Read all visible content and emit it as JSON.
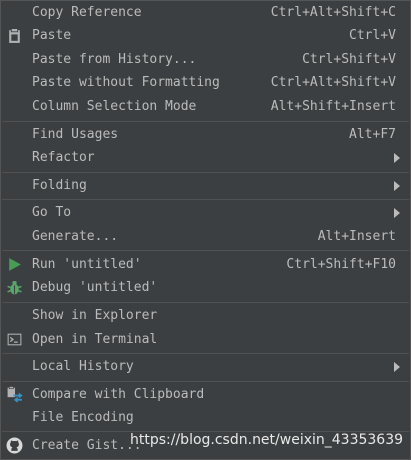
{
  "menu": {
    "copy_reference": {
      "label": "Copy Reference",
      "shortcut": "Ctrl+Alt+Shift+C"
    },
    "paste": {
      "label": "Paste",
      "shortcut": "Ctrl+V",
      "icon": "clipboard-icon"
    },
    "paste_from_history": {
      "label": "Paste from History...",
      "shortcut": "Ctrl+Shift+V"
    },
    "paste_without_formatting": {
      "label": "Paste without Formatting",
      "shortcut": "Ctrl+Alt+Shift+V"
    },
    "column_selection_mode": {
      "label": "Column Selection Mode",
      "shortcut": "Alt+Shift+Insert"
    },
    "find_usages": {
      "label": "Find Usages",
      "shortcut": "Alt+F7"
    },
    "refactor": {
      "label": "Refactor",
      "has_submenu": true
    },
    "folding": {
      "label": "Folding",
      "has_submenu": true
    },
    "go_to": {
      "label": "Go To",
      "has_submenu": true
    },
    "generate": {
      "label": "Generate...",
      "shortcut": "Alt+Insert"
    },
    "run": {
      "label": "Run 'untitled'",
      "shortcut": "Ctrl+Shift+F10",
      "icon": "run-triangle-icon"
    },
    "debug": {
      "label": "Debug 'untitled'",
      "icon": "debug-bug-icon"
    },
    "show_in_explorer": {
      "label": "Show in Explorer"
    },
    "open_in_terminal": {
      "label": "Open in Terminal",
      "icon": "terminal-icon"
    },
    "local_history": {
      "label": "Local History",
      "has_submenu": true
    },
    "compare_with_clipboard": {
      "label": "Compare with Clipboard",
      "icon": "compare-icon"
    },
    "file_encoding": {
      "label": "File Encoding"
    },
    "create_gist": {
      "label": "Create Gist...",
      "icon": "github-icon"
    }
  },
  "watermark": {
    "text": "https://blog.csdn.net/weixin_43353639"
  },
  "colors": {
    "background": "#3c3f41",
    "text": "#bbbbbb",
    "separator": "#515151",
    "run_green": "#499c54",
    "debug_green": "#59a869",
    "compare_blue": "#3592c4"
  }
}
